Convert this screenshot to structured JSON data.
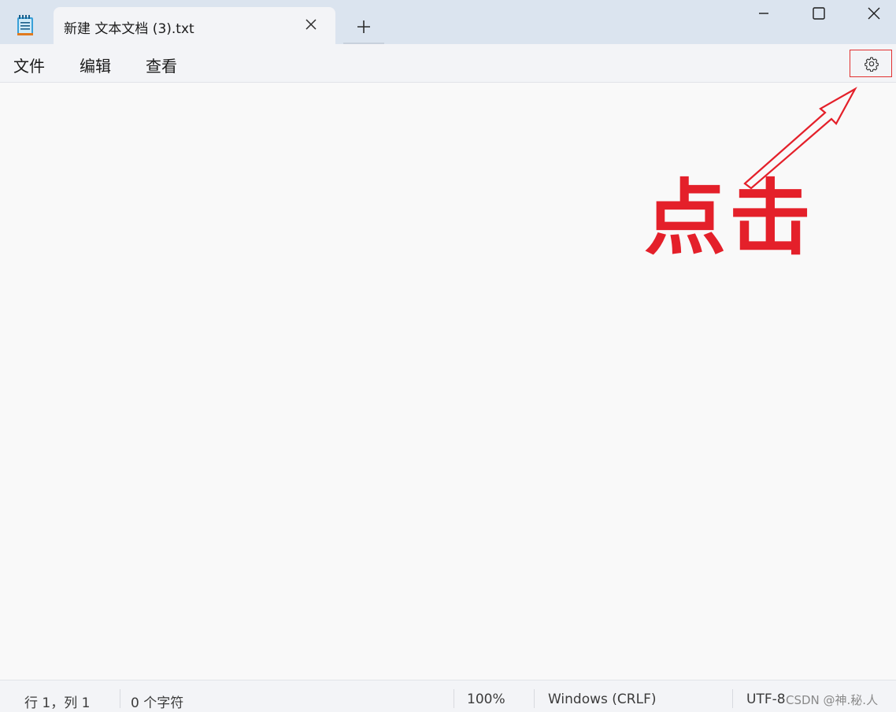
{
  "tab": {
    "title": "新建 文本文档 (3).txt"
  },
  "menu": {
    "file": "文件",
    "edit": "编辑",
    "view": "查看"
  },
  "icons": {
    "app": "notepad-icon",
    "close_tab": "close-icon",
    "new_tab": "plus-icon",
    "minimize": "minimize-icon",
    "maximize": "maximize-icon",
    "close_window": "close-icon",
    "settings": "gear-icon"
  },
  "editor": {
    "content": ""
  },
  "annotation": {
    "text": "点击",
    "color": "#e4202a"
  },
  "status": {
    "position": "行 1，列 1",
    "chars": "0 个字符",
    "zoom": "100%",
    "line_ending": "Windows (CRLF)",
    "encoding": "UTF-8"
  },
  "watermark": "CSDN @神.秘.人"
}
